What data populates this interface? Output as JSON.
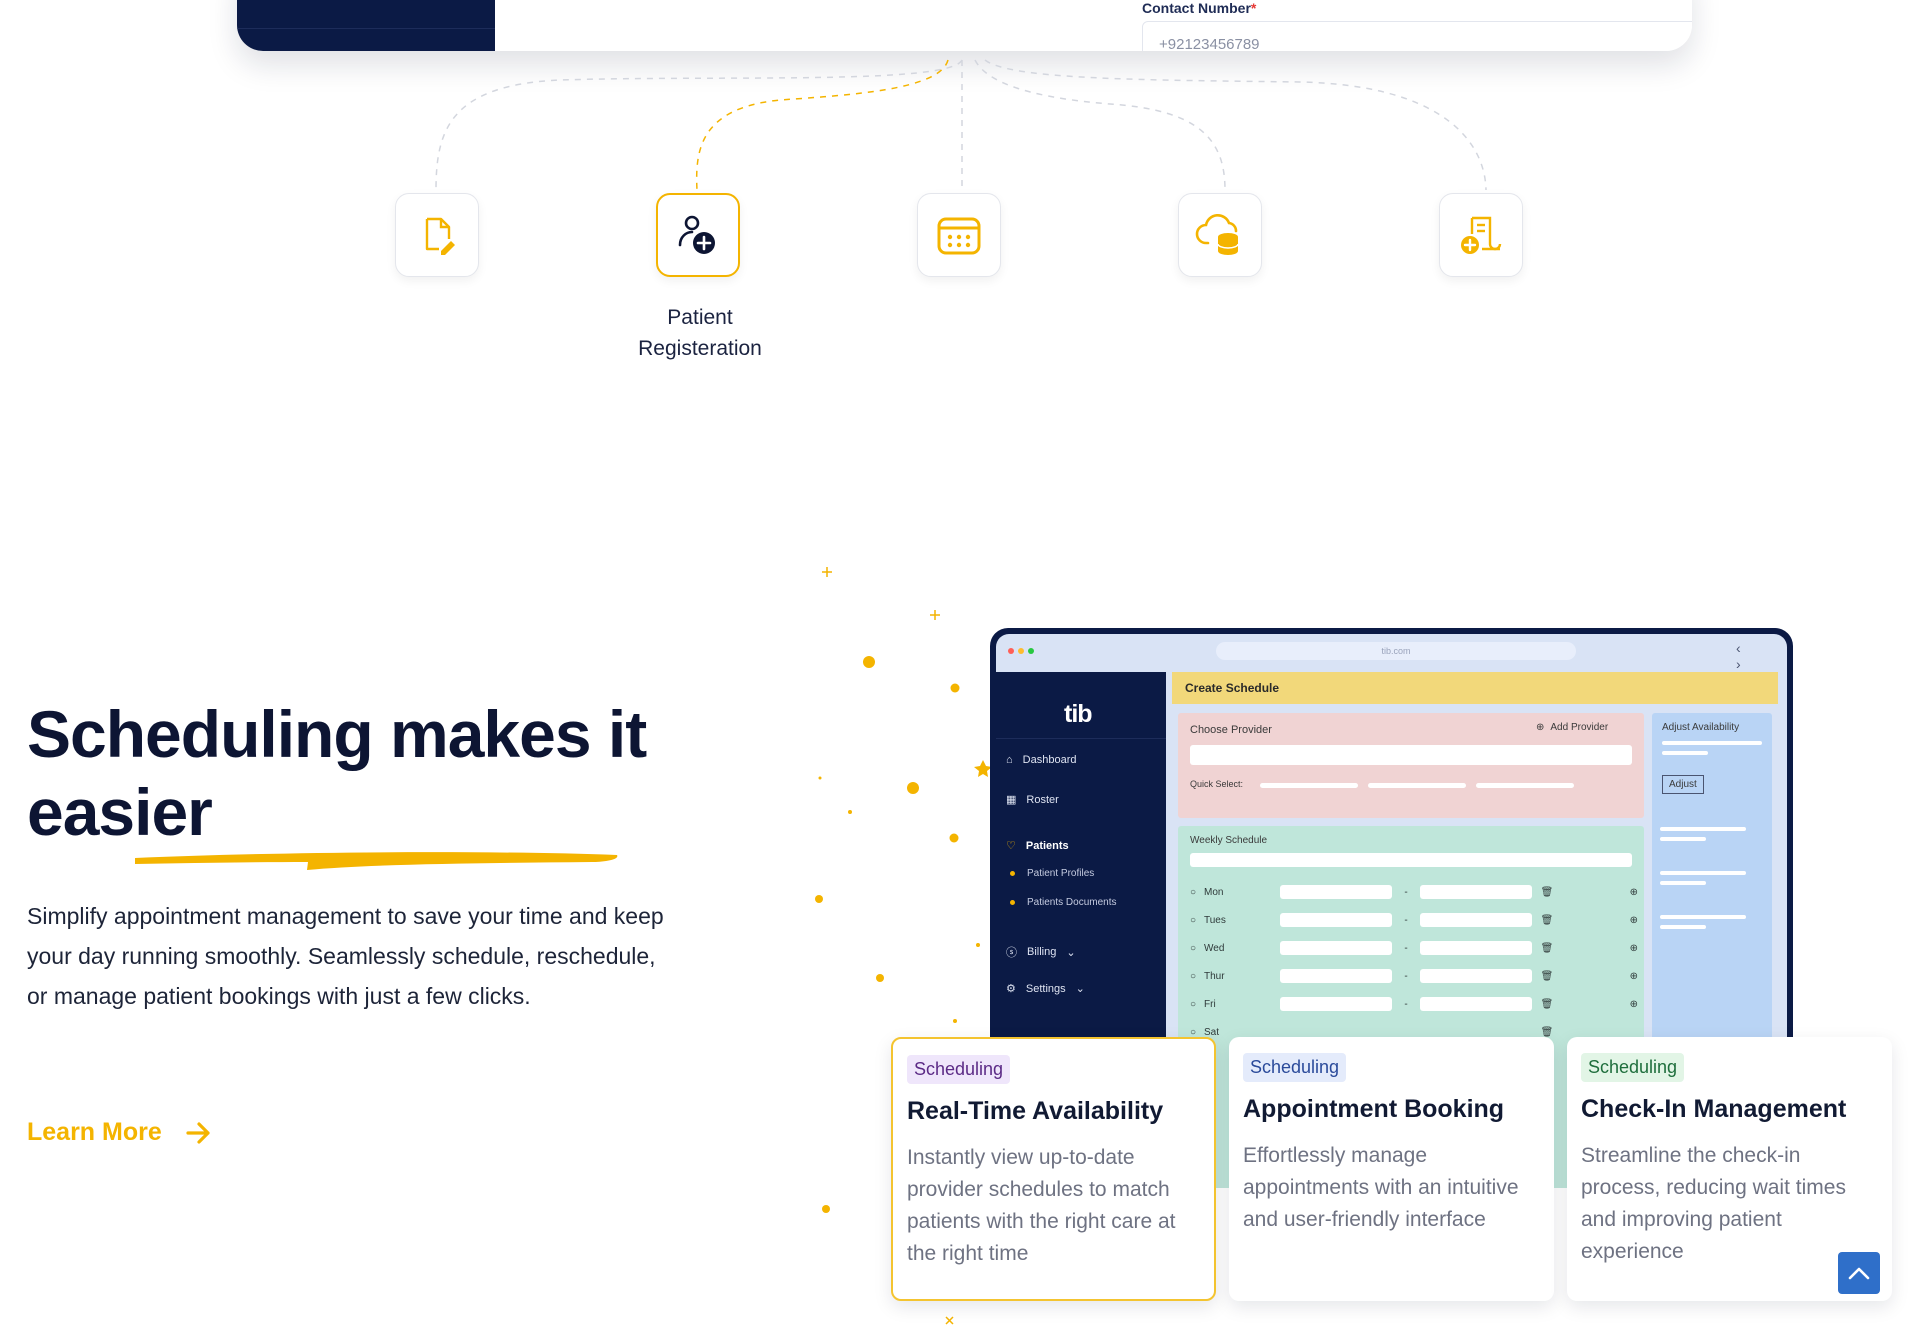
{
  "form": {
    "contact_label": "Contact Number",
    "required_mark": "*",
    "contact_placeholder": "+92123456789"
  },
  "process": {
    "icons": [
      "document-pen-icon",
      "user-add-icon",
      "calendar-icon",
      "cloud-database-icon",
      "invoice-add-icon"
    ],
    "active_label": "Patient Registeration"
  },
  "hero": {
    "headline": "Scheduling makes it easier",
    "description": "Simplify appointment management to save your time and keep your day running smoothly. Seamlessly schedule, reschedule, or manage patient bookings with just a few clicks.",
    "cta": "Learn More"
  },
  "mockup": {
    "url": "tib.com",
    "logo": "tib",
    "topbar_title": "Create Schedule",
    "sidebar": {
      "dashboard": "Dashboard",
      "roster": "Roster",
      "patients": "Patients",
      "patient_profiles": "Patient Profiles",
      "patients_documents": "Patients Documents",
      "billing": "Billing",
      "settings": "Settings"
    },
    "choose_provider": "Choose Provider",
    "add_provider": "Add Provider",
    "quick_select": "Quick Select:",
    "adjust_availability": "Adjust Availability",
    "adjust_button": "Adjust",
    "weekly_schedule": "Weekly Schedule",
    "days": [
      "Mon",
      "Tues",
      "Wed",
      "Thur",
      "Fri",
      "Sat"
    ]
  },
  "cards": [
    {
      "tag": "Scheduling",
      "title": "Real-Time Availability",
      "body": "Instantly view up-to-date provider schedules to match patients with the right care at the right time"
    },
    {
      "tag": "Scheduling",
      "title": "Appointment Booking",
      "body": "Effortlessly manage appointments with an intuitive and user-friendly interface"
    },
    {
      "tag": "Scheduling",
      "title": "Check-In Management",
      "body": "Streamline the check-in process, reducing wait times and improving patient experience"
    }
  ],
  "colors": {
    "accent": "#f4b400",
    "navy": "#0b1a45",
    "scroll_button": "#2f6fc9"
  }
}
